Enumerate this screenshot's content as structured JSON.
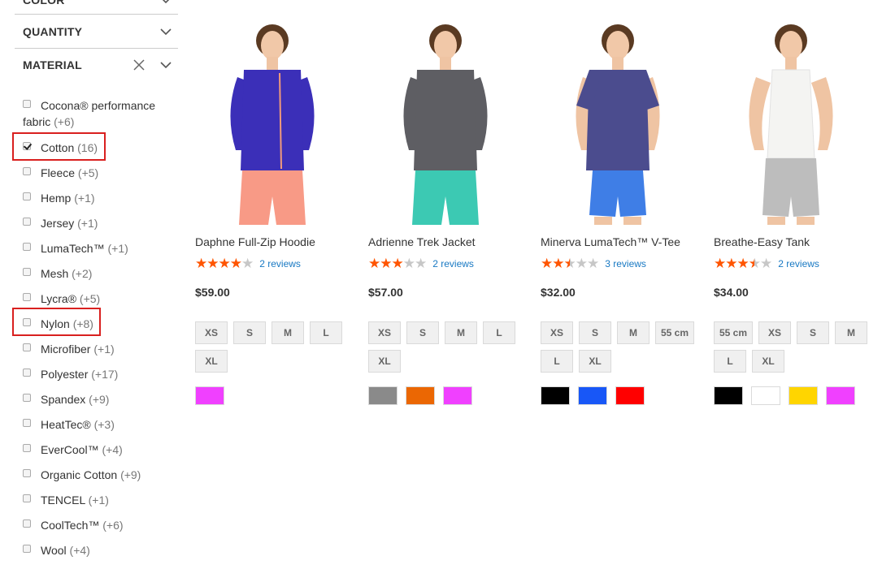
{
  "filters": {
    "color_label": "COLOR",
    "quantity_label": "QUANTITY",
    "material_label": "MATERIAL",
    "material_options": [
      {
        "name": "Cocona® performance",
        "name2": "fabric",
        "count": "(+6)",
        "checked": false
      },
      {
        "name": "Cotton",
        "count": "(16)",
        "checked": true
      },
      {
        "name": "Fleece",
        "count": "(+5)",
        "checked": false
      },
      {
        "name": "Hemp",
        "count": "(+1)",
        "checked": false
      },
      {
        "name": "Jersey",
        "count": "(+1)",
        "checked": false
      },
      {
        "name": "LumaTech™",
        "count": "(+1)",
        "checked": false
      },
      {
        "name": "Mesh",
        "count": "(+2)",
        "checked": false
      },
      {
        "name": "Lycra®",
        "count": "(+5)",
        "checked": false
      },
      {
        "name": "Nylon",
        "count": "(+8)",
        "checked": false
      },
      {
        "name": "Microfiber",
        "count": "(+1)",
        "checked": false
      },
      {
        "name": "Polyester",
        "count": "(+17)",
        "checked": false
      },
      {
        "name": "Spandex",
        "count": "(+9)",
        "checked": false
      },
      {
        "name": "HeatTec®",
        "count": "(+3)",
        "checked": false
      },
      {
        "name": "EverCool™",
        "count": "(+4)",
        "checked": false
      },
      {
        "name": "Organic Cotton",
        "count": "(+9)",
        "checked": false
      },
      {
        "name": "TENCEL",
        "count": "(+1)",
        "checked": false
      },
      {
        "name": "CoolTech™",
        "count": "(+6)",
        "checked": false
      },
      {
        "name": "Wool",
        "count": "(+4)",
        "checked": false
      }
    ]
  },
  "products": [
    {
      "name": "Daphne Full-Zip Hoodie",
      "rating": 4,
      "reviews": "2 reviews",
      "price": "$59.00",
      "sizes": [
        "XS",
        "S",
        "M",
        "L",
        "XL"
      ],
      "swatches": [
        "#f040ff"
      ],
      "top_color": "#3b2fb8",
      "bottom_color": "#f89a86"
    },
    {
      "name": "Adrienne Trek Jacket",
      "rating": 3,
      "reviews": "2 reviews",
      "price": "$57.00",
      "sizes": [
        "XS",
        "S",
        "M",
        "L",
        "XL"
      ],
      "swatches": [
        "#8a8a8a",
        "#eb6703",
        "#f040ff"
      ],
      "top_color": "#5e5e63",
      "bottom_color": "#3cc9b3"
    },
    {
      "name": "Minerva LumaTech™ V-Tee",
      "rating": 2.5,
      "reviews": "3 reviews",
      "price": "$32.00",
      "sizes": [
        "XS",
        "S",
        "M",
        "55 cm",
        "L",
        "XL"
      ],
      "swatches": [
        "#000000",
        "#1857f7",
        "#ff0000"
      ],
      "top_color": "#4b4c8e",
      "bottom_color": "#3f7ee6"
    },
    {
      "name": "Breathe-Easy Tank",
      "rating": 3.5,
      "reviews": "2 reviews",
      "price": "$34.00",
      "sizes": [
        "55 cm",
        "XS",
        "S",
        "M",
        "L",
        "XL"
      ],
      "swatches": [
        "#000000",
        "#ffffff",
        "#ffd500",
        "#f040ff"
      ],
      "top_color": "#f4f4f2",
      "bottom_color": "#bdbdbd"
    }
  ]
}
